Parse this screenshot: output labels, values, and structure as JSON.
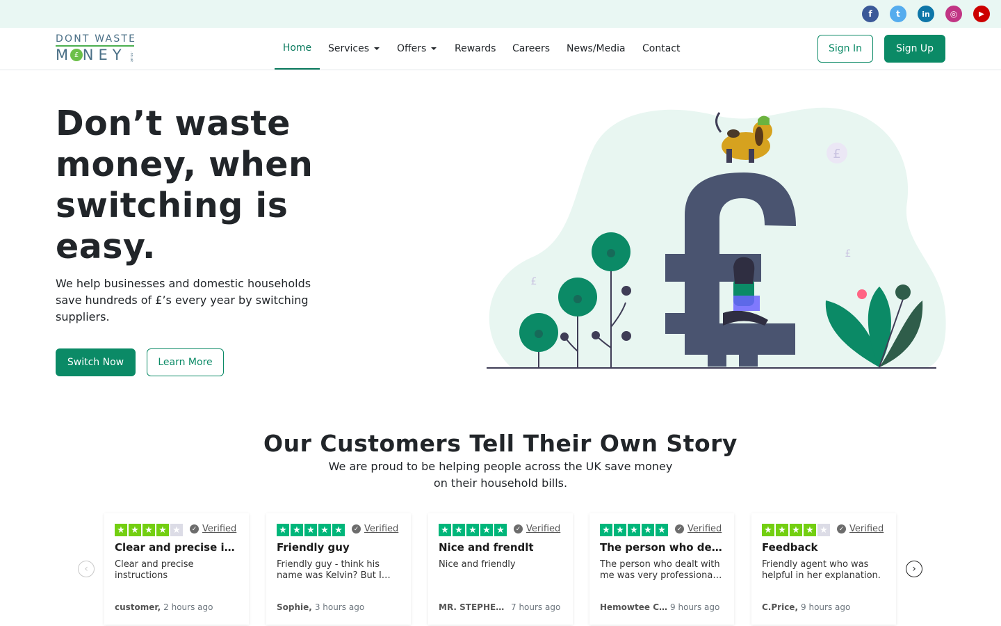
{
  "social": [
    {
      "name": "facebook",
      "glyph": "f",
      "color": "#3b5998"
    },
    {
      "name": "twitter",
      "glyph": "t",
      "color": "#55acee"
    },
    {
      "name": "linkedin",
      "glyph": "in",
      "color": "#0e76a8"
    },
    {
      "name": "instagram",
      "glyph": "◎",
      "color": "#c13584"
    },
    {
      "name": "youtube",
      "glyph": "▶",
      "color": "#cc0000"
    }
  ],
  "logo": {
    "line1": "DONT WASTE",
    "line2": "M NEY",
    "couk": ".co.uk"
  },
  "nav": {
    "items": [
      "Home",
      "Services",
      "Offers",
      "Rewards",
      "Careers",
      "News/Media",
      "Contact"
    ],
    "active": "Home"
  },
  "auth": {
    "sign_in": "Sign In",
    "sign_up": "Sign Up"
  },
  "hero": {
    "title": "Don’t waste money, when switching is easy.",
    "subtitle": "We help businesses and domestic households save hundreds of £’s every year by switching suppliers.",
    "primary_cta": "Switch Now",
    "secondary_cta": "Learn More"
  },
  "testimonials": {
    "title": "Our Customers Tell Their Own Story",
    "subtitle": "We are proud to be helping people across the UK save money on their household bills.",
    "verified_label": "Verified",
    "reviews": [
      {
        "rating": 4,
        "title": "Clear and precise in…",
        "body": "Clear and precise instructions",
        "author": "customer,",
        "time": "2 hours ago"
      },
      {
        "rating": 5,
        "title": "Friendly guy",
        "body": "Friendly guy - think his name was Kelvin? But I…",
        "author": "Sophie,",
        "time": "3 hours ago"
      },
      {
        "rating": 5,
        "title": "Nice and frendlt",
        "body": "Nice and friendly",
        "author": "MR. STEPHEN…",
        "time": "7 hours ago"
      },
      {
        "rating": 5,
        "title": "The person who deal…",
        "body": "The person who dealt with me was very professiona…",
        "author": "Hemowtee C…",
        "time": "9 hours ago"
      },
      {
        "rating": 4,
        "title": "Feedback",
        "body": "Friendly agent who was helpful in her explanation.",
        "author": "C.Price,",
        "time": "9 hours ago"
      }
    ]
  },
  "colors": {
    "brand": "#0b8a66",
    "trustpilot_green": "#00b67a",
    "star_empty": "#dcdce6"
  }
}
